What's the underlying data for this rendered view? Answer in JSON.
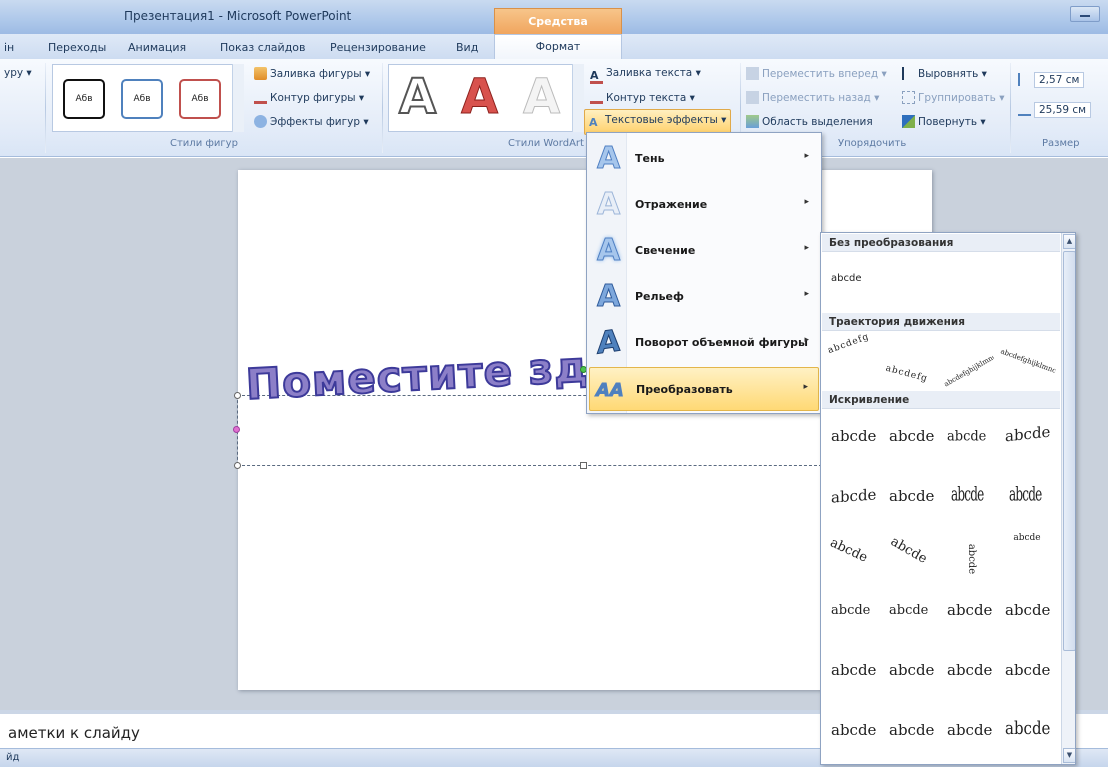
{
  "window": {
    "title": "Презентация1 - Microsoft PowerPoint",
    "contextual_group": "Средства рисования"
  },
  "tabs": [
    "ін",
    "Переходы",
    "Анимация",
    "Показ слайдов",
    "Рецензирование",
    "Вид"
  ],
  "active_tab": "Формат",
  "ribbon": {
    "left_cut": "уру ▾",
    "shape_styles": {
      "sample_text": "Абв",
      "fill": "Заливка фигуры ▾",
      "outline": "Контур фигуры ▾",
      "effects": "Эффекты фигур ▾",
      "group_label": "Стили фигур"
    },
    "wordart": {
      "sample": "A",
      "text_fill": "Заливка текста ▾",
      "text_outline": "Контур текста ▾",
      "text_effects": "Текстовые эффекты ▾",
      "group_label": "Стили WordArt"
    },
    "arrange": {
      "bring_forward": "Переместить вперед ▾",
      "send_backward": "Переместить назад ▾",
      "selection_pane": "Область выделения",
      "align": "Выровнять ▾",
      "group": "Группировать ▾",
      "rotate": "Повернуть ▾",
      "group_label": "Упорядочить"
    },
    "size": {
      "height": "2,57 см",
      "width": "25,59 см",
      "group_label": "Размер"
    }
  },
  "slide": {
    "wordart_text": "Поместите зд"
  },
  "notes": {
    "text": "аметки к слайду"
  },
  "status": {
    "text": "йд"
  },
  "text_effects_menu": {
    "items": [
      {
        "label": "Тень",
        "icon": "A"
      },
      {
        "label": "Отражение",
        "icon": "A"
      },
      {
        "label": "Свечение",
        "icon": "A"
      },
      {
        "label": "Рельеф",
        "icon": "A"
      },
      {
        "label": "Поворот объемной фигуры",
        "icon": "A"
      },
      {
        "label": "Преобразовать",
        "icon": "AA"
      }
    ],
    "arrow": "▸"
  },
  "transform_gallery": {
    "no_transform_header": "Без преобразования",
    "no_transform_sample": "abcde",
    "follow_path_header": "Траектория движения",
    "warp_header": "Искривление",
    "warp_sample": "abcde",
    "path_samples": [
      "abcdefg",
      "abcdefg",
      "abcdefghijklmnop",
      "abcdefghijklmnop"
    ]
  },
  "colors": {
    "accent": "#f0a55e",
    "menu_highlight": "#ffd975",
    "wordart_fill": "#8c7fc8",
    "wordart_outline": "#3d3a9a"
  }
}
